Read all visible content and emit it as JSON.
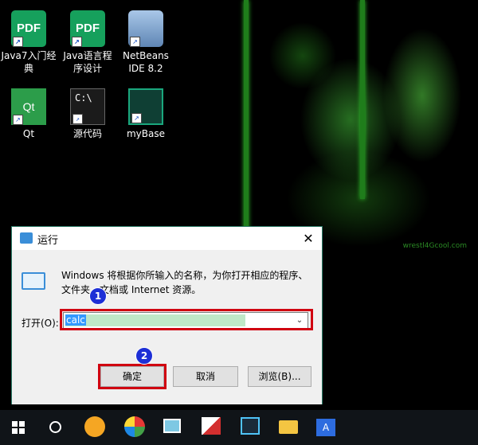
{
  "desktop": {
    "icons": [
      {
        "name": "java7-pdf",
        "label_line1": "Java7入门经",
        "label_line2": "典",
        "icon_text": "PDF",
        "shortcut": "↗"
      },
      {
        "name": "java-pdf",
        "label_line1": "Java语言程",
        "label_line2": "序设计",
        "icon_text": "PDF",
        "shortcut": "↗"
      },
      {
        "name": "netbeans",
        "label_line1": "NetBeans",
        "label_line2": "IDE 8.2",
        "icon_text": "",
        "shortcut": "↗"
      },
      {
        "name": "qt",
        "label_line1": "Qt",
        "label_line2": "",
        "icon_text": "Qt",
        "shortcut": "↗"
      },
      {
        "name": "source-code",
        "label_line1": "源代码",
        "label_line2": "",
        "icon_text": "C:\\",
        "shortcut": "↗"
      },
      {
        "name": "mybase",
        "label_line1": "myBase",
        "label_line2": "",
        "icon_text": "",
        "shortcut": "↗"
      }
    ],
    "wallpaper_text": "wrestl4Gcool.com"
  },
  "dialog": {
    "title": "运行",
    "close_glyph": "✕",
    "description": "Windows 将根据你所输入的名称，为你打开相应的程序、文件夹、文档或 Internet 资源。",
    "open_label": "打开(O):",
    "input_value": "calc",
    "dropdown_glyph": "⌄",
    "ok_label": "确定",
    "cancel_label": "取消",
    "browse_label": "浏览(B)...",
    "badge1": "1",
    "badge2": "2"
  },
  "taskbar": {
    "items": [
      "start",
      "cortana",
      "browser-app",
      "color-app",
      "monitor-app",
      "red-app",
      "terminal-app",
      "file-explorer",
      "language-indicator"
    ],
    "language_text": "A"
  },
  "colors": {
    "dialog_border": "#2a7a66",
    "highlight_red": "#d00010",
    "badge_blue": "#1d2fd6",
    "selection_blue": "#3399ff",
    "input_highlight": "#bfe8c8",
    "taskbar_bg": "#101418"
  }
}
